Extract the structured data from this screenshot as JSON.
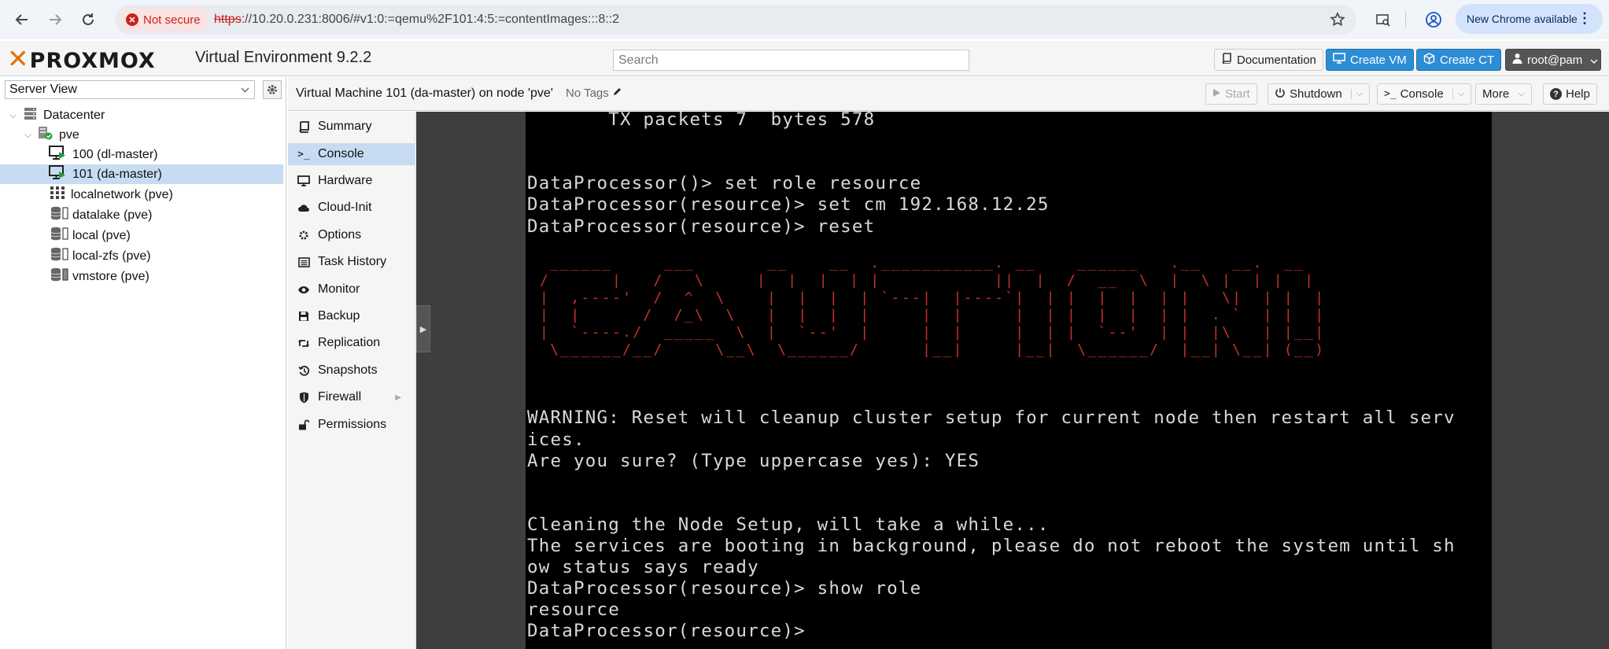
{
  "browser": {
    "security_label": "Not secure",
    "url_scheme": "https",
    "url_rest": "://10.20.0.231:8006/#v1:0:=qemu%2F101:4:5:=contentImages:::8::2",
    "update_label": "New Chrome available"
  },
  "app": {
    "logo_text": "PROXMOX",
    "version": "Virtual Environment 9.2.2",
    "search_placeholder": "Search",
    "documentation": "Documentation",
    "create_vm": "Create VM",
    "create_ct": "Create CT",
    "user": "root@pam"
  },
  "tree": {
    "view": "Server View",
    "items": [
      {
        "label": "Datacenter",
        "icon": "datacenter-icon"
      },
      {
        "label": "pve",
        "icon": "node-icon"
      },
      {
        "label": "100 (dl-master)",
        "icon": "vm-running-icon"
      },
      {
        "label": "101 (da-master)",
        "icon": "vm-running-icon",
        "selected": true
      },
      {
        "label": "localnetwork (pve)",
        "icon": "network-grid-icon"
      },
      {
        "label": "datalake (pve)",
        "icon": "storage-icon"
      },
      {
        "label": "local (pve)",
        "icon": "storage-icon"
      },
      {
        "label": "local-zfs (pve)",
        "icon": "storage-icon"
      },
      {
        "label": "vmstore (pve)",
        "icon": "storage-icon"
      }
    ]
  },
  "content": {
    "title": "Virtual Machine 101 (da-master) on node 'pve'",
    "tags": "No Tags",
    "start": "Start",
    "shutdown": "Shutdown",
    "console": "Console",
    "more": "More",
    "help": "Help"
  },
  "menu": {
    "items": [
      {
        "label": "Summary",
        "icon": "book-icon"
      },
      {
        "label": "Console",
        "icon": "terminal-icon",
        "selected": true
      },
      {
        "label": "Hardware",
        "icon": "monitor-icon"
      },
      {
        "label": "Cloud-Init",
        "icon": "cloud-icon"
      },
      {
        "label": "Options",
        "icon": "gear-icon"
      },
      {
        "label": "Task History",
        "icon": "list-icon"
      },
      {
        "label": "Monitor",
        "icon": "eye-icon"
      },
      {
        "label": "Backup",
        "icon": "floppy-icon"
      },
      {
        "label": "Replication",
        "icon": "retweet-icon"
      },
      {
        "label": "Snapshots",
        "icon": "history-icon"
      },
      {
        "label": "Firewall",
        "icon": "shield-icon",
        "has_submenu": true
      },
      {
        "label": "Permissions",
        "icon": "unlock-icon"
      }
    ]
  },
  "terminal": {
    "lines": [
      "       TX packets 7  bytes 578",
      "",
      "",
      "DataProcessor()> set role resource",
      "DataProcessor(resource)> set cm 192.168.12.25",
      "DataProcessor(resource)> reset",
      "",
      "",
      "",
      "",
      "",
      "",
      "",
      "",
      "WARNING: Reset will cleanup cluster setup for current node then restart all serv",
      "ices.",
      "Are you sure? (Type uppercase yes): YES",
      "",
      "",
      "Cleaning the Node Setup, will take a while...",
      "The services are booting in background, please do not reboot the system until sh",
      "ow status says ready",
      "DataProcessor(resource)> show role",
      "resource",
      "DataProcessor(resource)>"
    ],
    "banner": " ______     ___       __    __  .___________. __    ______   .__   __.  __\n/      |   /   \\     |  |  |  | |           ||  |  /  __  \\  |  \\ |  | |  |\n|  ,----'  /  ^  \\    |  |  |  | `---|  |----`|  | |  |  |  | |   \\|  | |  |\n|  |      /  /_\\  \\   |  |  |  |     |  |     |  | |  |  |  | |  . `  | |  |\n|  `----./  _____  \\  |  `--'  |     |  |     |  | |  `--'  | |  |\\   | |__|\n \\______/__/     \\__\\  \\______/      |__|     |__|  \\______/  |__| \\__| (__)",
    "banner_color": "#c83228"
  }
}
